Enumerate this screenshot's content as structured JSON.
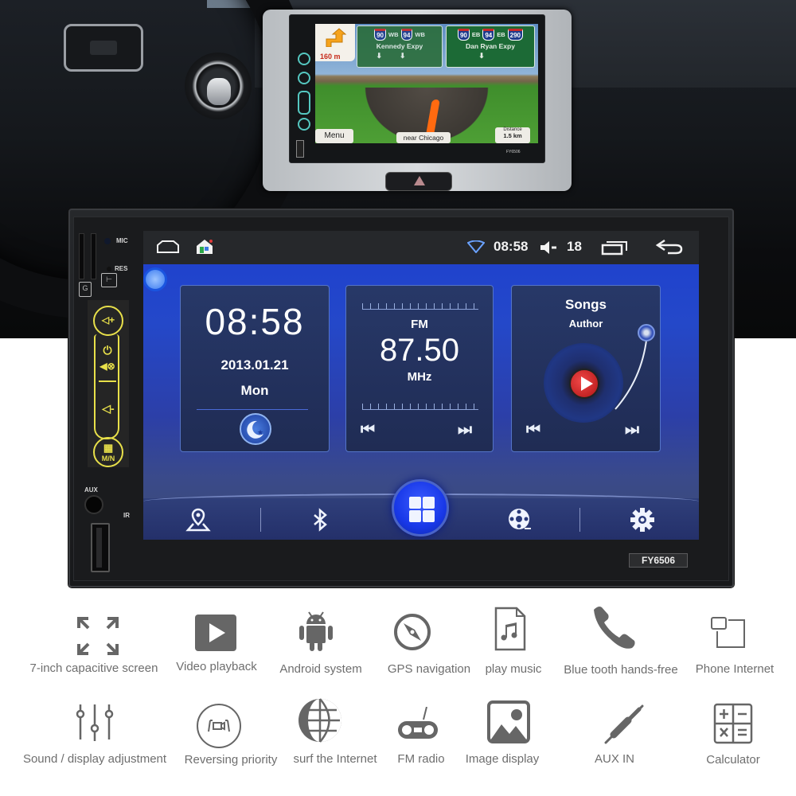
{
  "mini_display": {
    "turn_distance": "160 m",
    "signs": [
      {
        "shields": [
          "90",
          "WB",
          "94",
          "WB"
        ],
        "name": "Kennedy Expy",
        "arrows": "⬇⬇"
      },
      {
        "shields": [
          "90",
          "EB",
          "94",
          "EB",
          "290"
        ],
        "name": "Dan Ryan Expy",
        "arrows": "⬇"
      }
    ],
    "menu_button": "Menu",
    "location": "near Chicago",
    "distance_label": "Distance",
    "distance_value": "1.5 km",
    "model": "FY6506"
  },
  "head_unit": {
    "panel_labels": {
      "mic": "MIC",
      "res": "RES",
      "sd": "G",
      "aux": "AUX",
      "ir": "IR"
    },
    "buttons": {
      "vol_up": "◁+",
      "power": "⏻",
      "mute": "◀⊗",
      "vol_down": "◁-",
      "menu": "M/N"
    },
    "model_badge": "FY6506"
  },
  "statusbar": {
    "time": "08:58",
    "volume": "18",
    "icons": [
      "home-icon",
      "app-store-icon",
      "wifi-icon",
      "volume-icon",
      "recent-apps-icon",
      "back-icon"
    ]
  },
  "widgets": {
    "clock": {
      "time": "08:58",
      "date": "2013.01.21",
      "day": "Mon"
    },
    "radio": {
      "band": "FM",
      "frequency": "87.50",
      "unit": "MHz",
      "prev": "⏮",
      "next": "⏭"
    },
    "music": {
      "title": "Songs",
      "author": "Author",
      "prev": "⏮",
      "next": "⏭"
    }
  },
  "dock": {
    "items": [
      "navigation",
      "bluetooth",
      "apps",
      "video",
      "settings"
    ]
  },
  "features": [
    {
      "label": "7-inch capacitive screen",
      "icon": "expand-icon"
    },
    {
      "label": "Video playback",
      "icon": "play-icon"
    },
    {
      "label": "Android system",
      "icon": "android-icon"
    },
    {
      "label": "GPS navigation",
      "icon": "compass-icon"
    },
    {
      "label": "play music",
      "icon": "music-file-icon"
    },
    {
      "label": "Blue tooth hands-free",
      "icon": "phone-icon"
    },
    {
      "label": "Phone Internet",
      "icon": "screen-mirror-icon"
    },
    {
      "label": "Sound / display adjustment",
      "icon": "sliders-icon"
    },
    {
      "label": "Reversing priority",
      "icon": "reverse-camera-icon"
    },
    {
      "label": "surf the Internet",
      "icon": "globe-icon"
    },
    {
      "label": "FM radio",
      "icon": "radio-icon"
    },
    {
      "label": "Image display",
      "icon": "image-icon"
    },
    {
      "label": "AUX IN",
      "icon": "aux-jack-icon"
    },
    {
      "label": "Calculator",
      "icon": "calculator-icon"
    }
  ]
}
